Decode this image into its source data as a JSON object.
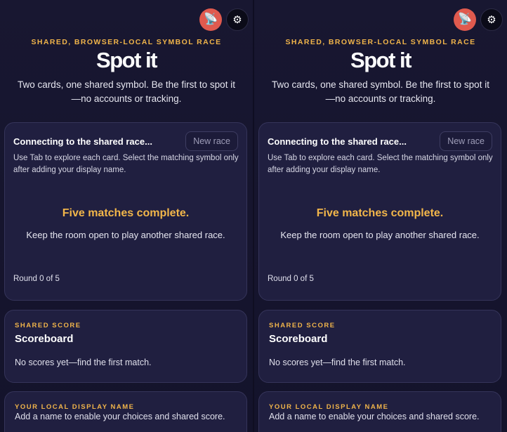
{
  "panes": [
    {
      "icons": {
        "sound": "satellite-dish-icon",
        "settings": "gear-icon"
      },
      "header": {
        "eyebrow": "SHARED, BROWSER-LOCAL SYMBOL RACE",
        "title": "Spot it",
        "subtitle": "Two cards, one shared symbol. Be the first to spot it—no accounts or tracking."
      },
      "game": {
        "status": "Connecting to the shared race...",
        "new_race_label": "New race",
        "instructions": "Use Tab to explore each card. Select the matching symbol only after adding your display name.",
        "complete_message": "Five matches complete.",
        "keep_open_message": "Keep the room open to play another shared race.",
        "round_text": "Round 0 of 5"
      },
      "scoreboard": {
        "eyebrow": "SHARED SCORE",
        "title": "Scoreboard",
        "empty_text": "No scores yet—find the first match."
      },
      "display_name": {
        "eyebrow": "YOUR LOCAL DISPLAY NAME",
        "text": "Add a name to enable your choices and shared score."
      }
    },
    {
      "icons": {
        "sound": "satellite-dish-icon",
        "settings": "gear-icon"
      },
      "header": {
        "eyebrow": "SHARED, BROWSER-LOCAL SYMBOL RACE",
        "title": "Spot it",
        "subtitle": "Two cards, one shared symbol. Be the first to spot it—no accounts or tracking."
      },
      "game": {
        "status": "Connecting to the shared race...",
        "new_race_label": "New race",
        "instructions": "Use Tab to explore each card. Select the matching symbol only after adding your display name.",
        "complete_message": "Five matches complete.",
        "keep_open_message": "Keep the room open to play another shared race.",
        "round_text": "Round 0 of 5"
      },
      "scoreboard": {
        "eyebrow": "SHARED SCORE",
        "title": "Scoreboard",
        "empty_text": "No scores yet—find the first match."
      },
      "display_name": {
        "eyebrow": "YOUR LOCAL DISPLAY NAME",
        "text": "Add a name to enable your choices and shared score."
      }
    }
  ]
}
